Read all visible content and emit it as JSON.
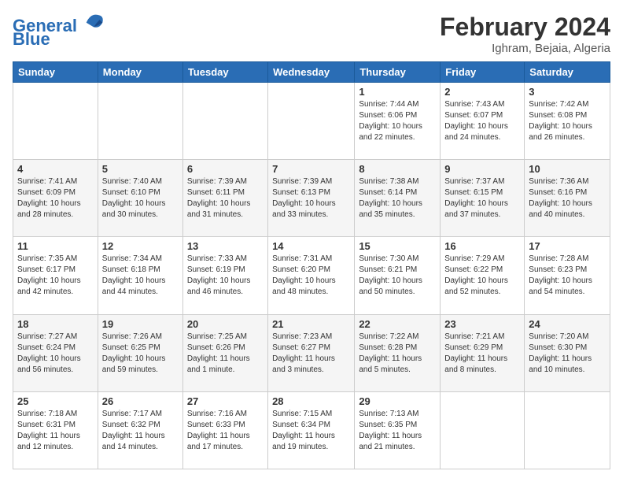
{
  "header": {
    "logo_line1": "General",
    "logo_line2": "Blue",
    "month": "February 2024",
    "location": "Ighram, Bejaia, Algeria"
  },
  "weekdays": [
    "Sunday",
    "Monday",
    "Tuesday",
    "Wednesday",
    "Thursday",
    "Friday",
    "Saturday"
  ],
  "weeks": [
    [
      {
        "day": "",
        "info": ""
      },
      {
        "day": "",
        "info": ""
      },
      {
        "day": "",
        "info": ""
      },
      {
        "day": "",
        "info": ""
      },
      {
        "day": "1",
        "info": "Sunrise: 7:44 AM\nSunset: 6:06 PM\nDaylight: 10 hours\nand 22 minutes."
      },
      {
        "day": "2",
        "info": "Sunrise: 7:43 AM\nSunset: 6:07 PM\nDaylight: 10 hours\nand 24 minutes."
      },
      {
        "day": "3",
        "info": "Sunrise: 7:42 AM\nSunset: 6:08 PM\nDaylight: 10 hours\nand 26 minutes."
      }
    ],
    [
      {
        "day": "4",
        "info": "Sunrise: 7:41 AM\nSunset: 6:09 PM\nDaylight: 10 hours\nand 28 minutes."
      },
      {
        "day": "5",
        "info": "Sunrise: 7:40 AM\nSunset: 6:10 PM\nDaylight: 10 hours\nand 30 minutes."
      },
      {
        "day": "6",
        "info": "Sunrise: 7:39 AM\nSunset: 6:11 PM\nDaylight: 10 hours\nand 31 minutes."
      },
      {
        "day": "7",
        "info": "Sunrise: 7:39 AM\nSunset: 6:13 PM\nDaylight: 10 hours\nand 33 minutes."
      },
      {
        "day": "8",
        "info": "Sunrise: 7:38 AM\nSunset: 6:14 PM\nDaylight: 10 hours\nand 35 minutes."
      },
      {
        "day": "9",
        "info": "Sunrise: 7:37 AM\nSunset: 6:15 PM\nDaylight: 10 hours\nand 37 minutes."
      },
      {
        "day": "10",
        "info": "Sunrise: 7:36 AM\nSunset: 6:16 PM\nDaylight: 10 hours\nand 40 minutes."
      }
    ],
    [
      {
        "day": "11",
        "info": "Sunrise: 7:35 AM\nSunset: 6:17 PM\nDaylight: 10 hours\nand 42 minutes."
      },
      {
        "day": "12",
        "info": "Sunrise: 7:34 AM\nSunset: 6:18 PM\nDaylight: 10 hours\nand 44 minutes."
      },
      {
        "day": "13",
        "info": "Sunrise: 7:33 AM\nSunset: 6:19 PM\nDaylight: 10 hours\nand 46 minutes."
      },
      {
        "day": "14",
        "info": "Sunrise: 7:31 AM\nSunset: 6:20 PM\nDaylight: 10 hours\nand 48 minutes."
      },
      {
        "day": "15",
        "info": "Sunrise: 7:30 AM\nSunset: 6:21 PM\nDaylight: 10 hours\nand 50 minutes."
      },
      {
        "day": "16",
        "info": "Sunrise: 7:29 AM\nSunset: 6:22 PM\nDaylight: 10 hours\nand 52 minutes."
      },
      {
        "day": "17",
        "info": "Sunrise: 7:28 AM\nSunset: 6:23 PM\nDaylight: 10 hours\nand 54 minutes."
      }
    ],
    [
      {
        "day": "18",
        "info": "Sunrise: 7:27 AM\nSunset: 6:24 PM\nDaylight: 10 hours\nand 56 minutes."
      },
      {
        "day": "19",
        "info": "Sunrise: 7:26 AM\nSunset: 6:25 PM\nDaylight: 10 hours\nand 59 minutes."
      },
      {
        "day": "20",
        "info": "Sunrise: 7:25 AM\nSunset: 6:26 PM\nDaylight: 11 hours\nand 1 minute."
      },
      {
        "day": "21",
        "info": "Sunrise: 7:23 AM\nSunset: 6:27 PM\nDaylight: 11 hours\nand 3 minutes."
      },
      {
        "day": "22",
        "info": "Sunrise: 7:22 AM\nSunset: 6:28 PM\nDaylight: 11 hours\nand 5 minutes."
      },
      {
        "day": "23",
        "info": "Sunrise: 7:21 AM\nSunset: 6:29 PM\nDaylight: 11 hours\nand 8 minutes."
      },
      {
        "day": "24",
        "info": "Sunrise: 7:20 AM\nSunset: 6:30 PM\nDaylight: 11 hours\nand 10 minutes."
      }
    ],
    [
      {
        "day": "25",
        "info": "Sunrise: 7:18 AM\nSunset: 6:31 PM\nDaylight: 11 hours\nand 12 minutes."
      },
      {
        "day": "26",
        "info": "Sunrise: 7:17 AM\nSunset: 6:32 PM\nDaylight: 11 hours\nand 14 minutes."
      },
      {
        "day": "27",
        "info": "Sunrise: 7:16 AM\nSunset: 6:33 PM\nDaylight: 11 hours\nand 17 minutes."
      },
      {
        "day": "28",
        "info": "Sunrise: 7:15 AM\nSunset: 6:34 PM\nDaylight: 11 hours\nand 19 minutes."
      },
      {
        "day": "29",
        "info": "Sunrise: 7:13 AM\nSunset: 6:35 PM\nDaylight: 11 hours\nand 21 minutes."
      },
      {
        "day": "",
        "info": ""
      },
      {
        "day": "",
        "info": ""
      }
    ]
  ]
}
